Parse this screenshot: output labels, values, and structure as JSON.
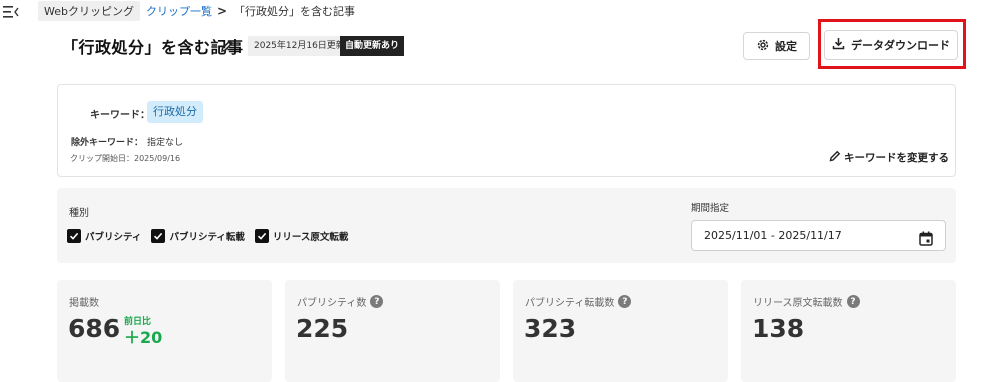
{
  "breadcrumb": {
    "home": "Webクリッピング",
    "list": "クリップ一覧",
    "separator": ">",
    "current": "「行政処分」を含む記事"
  },
  "header": {
    "title": "「行政処分」を含む記事",
    "updated": "2025年12月16日更新",
    "auto_badge": "自動更新あり",
    "settings_label": "設定",
    "download_label": "データダウンロード",
    "highlight_color": "#e0121a"
  },
  "keyword_card": {
    "keyword_label": "キーワード：",
    "keyword": "行政処分",
    "exclude_label": "除外キーワード：",
    "exclude_value": "指定なし",
    "start_date": "クリップ開始日：2025/09/16",
    "change_label": "キーワードを変更する"
  },
  "filters": {
    "type_label": "種別",
    "types": [
      {
        "label": "パブリシティ",
        "checked": true
      },
      {
        "label": "パブリシティ転載",
        "checked": true
      },
      {
        "label": "リリース原文転載",
        "checked": true
      }
    ],
    "period_label": "期間指定",
    "period_value": "2025/11/01 - 2025/11/17"
  },
  "stats": [
    {
      "label": "掲載数",
      "value": "686",
      "diff_label": "前日比",
      "diff": "＋20",
      "help": false
    },
    {
      "label": "パブリシティ数",
      "value": "225",
      "help": true
    },
    {
      "label": "パブリシティ転載数",
      "value": "323",
      "help": true
    },
    {
      "label": "リリース原文転載数",
      "value": "138",
      "help": true
    }
  ],
  "colors": {
    "accent_link": "#1a6fc9",
    "keyword_tag_bg": "#d2ecfb",
    "positive": "#1aa84c"
  }
}
